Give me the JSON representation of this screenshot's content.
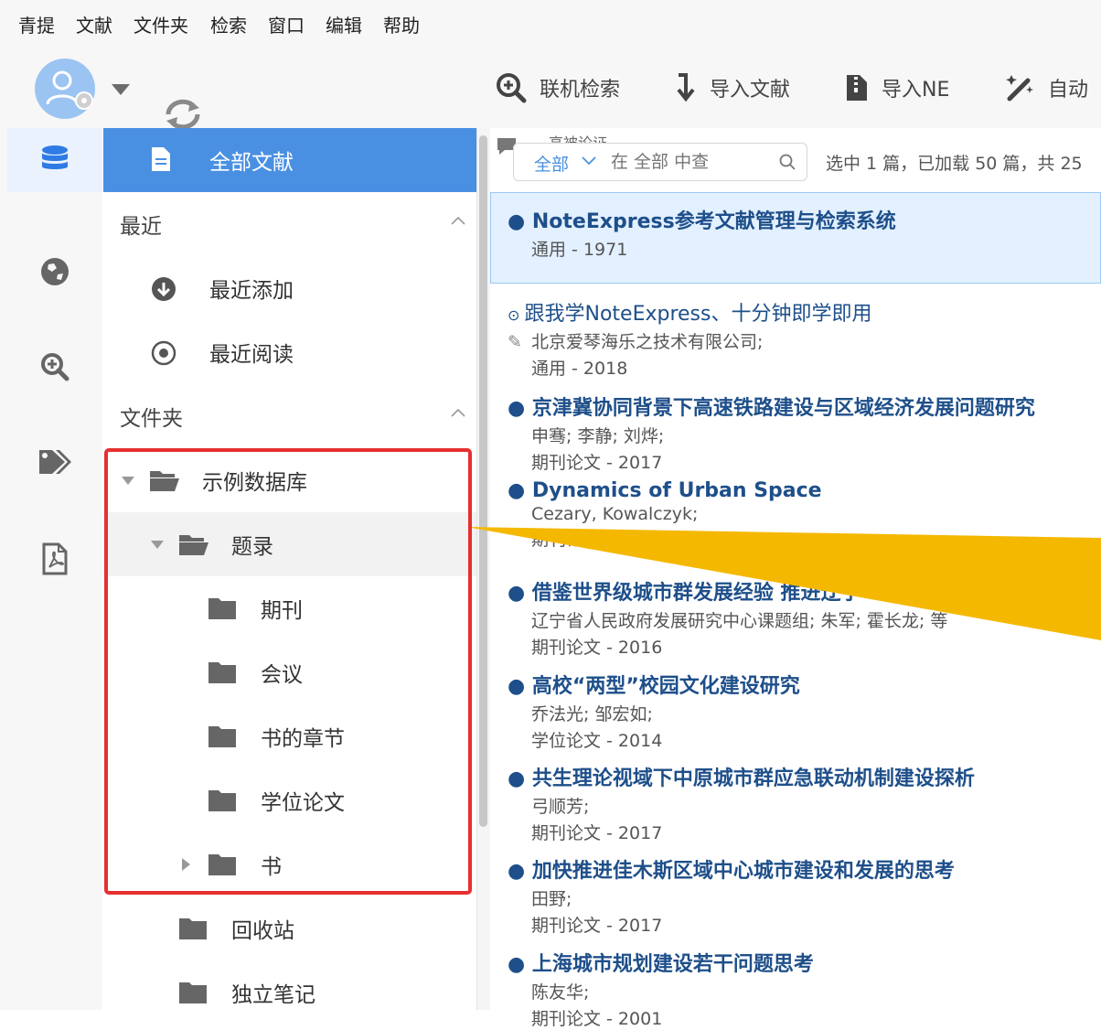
{
  "menu": [
    "青提",
    "文献",
    "文件夹",
    "检索",
    "窗口",
    "编辑",
    "帮助"
  ],
  "toolbar": {
    "online_search": "联机检索",
    "import_refs": "导入文献",
    "import_ne": "导入NE",
    "auto": "自动"
  },
  "tree": {
    "all_refs": "全部文献",
    "recent_header": "最近",
    "recent_added": "最近添加",
    "recent_read": "最近阅读",
    "folders_header": "文件夹",
    "sample_db": "示例数据库",
    "catalog": "题录",
    "journal": "期刊",
    "conference": "会议",
    "book_chapter": "书的章节",
    "thesis": "学位论文",
    "book": "书",
    "recycle": "回收站",
    "notes": "独立笔记"
  },
  "list": {
    "partial_tab": "高被论证",
    "filter_value": "全部",
    "search_placeholder": "在 全部 中查",
    "status": "选中 1 篇，已加载 50 篇，共 25",
    "entries": [
      {
        "title": "NoteExpress参考文献管理与检索系统",
        "authors": "",
        "meta": "通用 - 1971"
      },
      {
        "title": "跟我学NoteExpress、十分钟即学即用",
        "authors": "北京爱琴海乐之技术有限公司;",
        "meta": "通用 - 2018"
      },
      {
        "title": "京津冀协同背景下高速铁路建设与区域经济发展问题研究",
        "authors": "申骞; 李静; 刘烨;",
        "meta": "期刊论文 - 2017"
      },
      {
        "title": "Dynamics of Urban Space",
        "authors": "Cezary, Kowalczyk;",
        "meta": "期刊论文"
      },
      {
        "title": "借鉴世界级城市群发展经验 推进辽宁",
        "authors": "辽宁省人民政府发展研究中心课题组; 朱军; 霍长龙; 等",
        "meta": "期刊论文 - 2016"
      },
      {
        "title": "高校“两型”校园文化建设研究",
        "authors": "乔法光; 邹宏如;",
        "meta": "学位论文 - 2014"
      },
      {
        "title": "共生理论视域下中原城市群应急联动机制建设探析",
        "authors": "弓顺芳;",
        "meta": "期刊论文 - 2017"
      },
      {
        "title": "加快推进佳木斯区域中心城市建设和发展的思考",
        "authors": "田野;",
        "meta": "期刊论文 - 2017"
      },
      {
        "title": "上海城市规划建设若干问题思考",
        "authors": "陈友华;",
        "meta": "期刊论文 - 2001"
      }
    ]
  },
  "colors": {
    "accent": "#4a90e2",
    "highlight_box": "#e63030",
    "callout": "#f5b800",
    "title_blue": "#1e4f8a"
  }
}
